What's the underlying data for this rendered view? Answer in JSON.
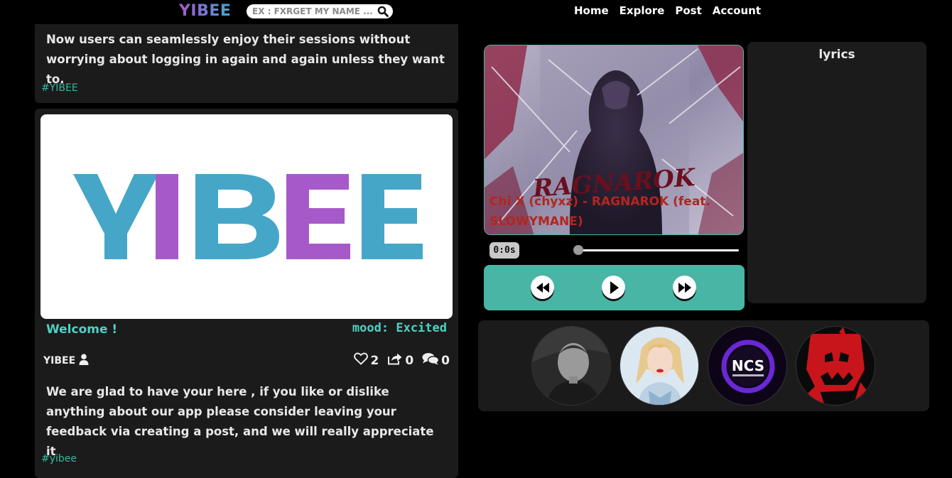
{
  "header": {
    "logo": "YIBEE",
    "search_placeholder": "EX : FXRGET MY NAME ....",
    "nav": [
      "Home",
      "Explore",
      "Post",
      "Account"
    ]
  },
  "feed": {
    "post1": {
      "text": "Now users can seamlessly enjoy their sessions without worrying about logging in again and again unless they want to.",
      "hashtag": "#YIBEE"
    },
    "post2": {
      "image_text": "YIBEE",
      "title": "Welcome !",
      "mood_label": "mood:",
      "mood_value": "Excited",
      "author": "YIBEE",
      "likes": "2",
      "shares": "0",
      "comments": "0",
      "text": "We are glad to have your here , if you like or dislike anything about our app please consider leaving your feedback via creating a post, and we will really appreciate it",
      "hashtag": "#yibee"
    }
  },
  "player": {
    "song_title": "Chi X (chyxz) - RAGNAROK (feat. SLOWYMANE)",
    "album_art_text": "RAGNAROK",
    "time": "0:0s",
    "progress": 0.0
  },
  "lyrics": {
    "title": "lyrics"
  },
  "colors": {
    "accent": "#48b5a5",
    "purple": "#a65ac9",
    "teal_text": "#4fd1c5",
    "card_bg": "#1b1b1b"
  },
  "icons": {
    "search": "search-icon",
    "user": "user-icon",
    "like": "heart-icon",
    "share": "share-icon",
    "comment": "comments-icon",
    "rewind": "backward-icon",
    "play": "play-icon",
    "forward": "forward-icon"
  },
  "artists": [
    "artist-1",
    "artist-2",
    "ncs",
    "artist-4"
  ],
  "artist_logo_text": "NCS"
}
